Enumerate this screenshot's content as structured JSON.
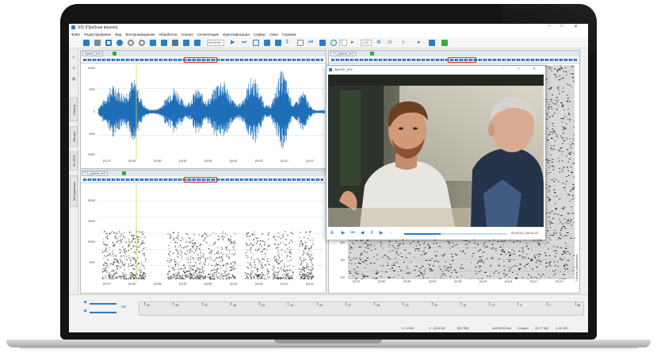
{
  "app": {
    "title": "SIS (Пробная версия)",
    "window_controls": [
      "–",
      "□",
      "✕"
    ]
  },
  "menu": [
    "Файл",
    "Редактирование",
    "Вид",
    "Воспроизведение",
    "Обработка",
    "Анализ",
    "Сегментация",
    "Идентификация",
    "Сервис",
    "Окна",
    "Справка"
  ],
  "toolbar": {
    "time_input": "00:00:00",
    "zoom_value": "2",
    "zoom2_value": "1.00"
  },
  "rail": {
    "tabs": [
      "Спектр",
      "Фильтр",
      "3D БПФ",
      "Метаданные"
    ]
  },
  "waveform_panel": {
    "tab": "speech_en2",
    "y_ticks": [
      "10000",
      "5000",
      "0",
      "-5000",
      "-10000"
    ],
    "x_ticks": [
      "[03,75",
      "[03,80",
      "[03,85",
      "[03,90",
      "[03,95",
      "[04,00",
      "[04,05",
      "[04,10",
      "[04,15"
    ]
  },
  "spectrogram_panel": {
    "tab": "7 s_speech_en2",
    "y_ticks": [
      "20000",
      "15000",
      "10000",
      "5000"
    ],
    "x_ticks": [
      "[03,75",
      "[03,80",
      "[03,85",
      "[03,90",
      "[03,95",
      "[04,00",
      "[04,05",
      "[04,10",
      "[04,15"
    ]
  },
  "right_panel": {
    "tab": "7 s_speech_en1",
    "y_ticks": [
      "100",
      "150",
      "200"
    ],
    "x_ticks": [
      "[03,75",
      "[03,80",
      "[03,85",
      "[03,90",
      "[03,95",
      "[04,00",
      "[04,05",
      "[04,10",
      "[04,15"
    ],
    "side_label": "Панель управления"
  },
  "video_window": {
    "title": "speech_en2",
    "time": "00:00:32 | 00:01:37",
    "progress": 0.35
  },
  "timeline": {
    "labels": [
      "-60",
      "-56",
      "-52",
      "-48",
      "-44",
      "-40",
      "-36",
      "-32",
      "-28",
      "-24",
      "-20",
      "-16",
      "-12",
      "-8",
      "-4",
      "dB"
    ]
  },
  "status": {
    "x": "X: 0.000",
    "y": "Y: -2242.83",
    "y_extra": "[53.785]",
    "format": "44100/32-бит",
    "channels": "Стерео",
    "size": "39.77 МБ",
    "duration": "1:31:100"
  }
}
